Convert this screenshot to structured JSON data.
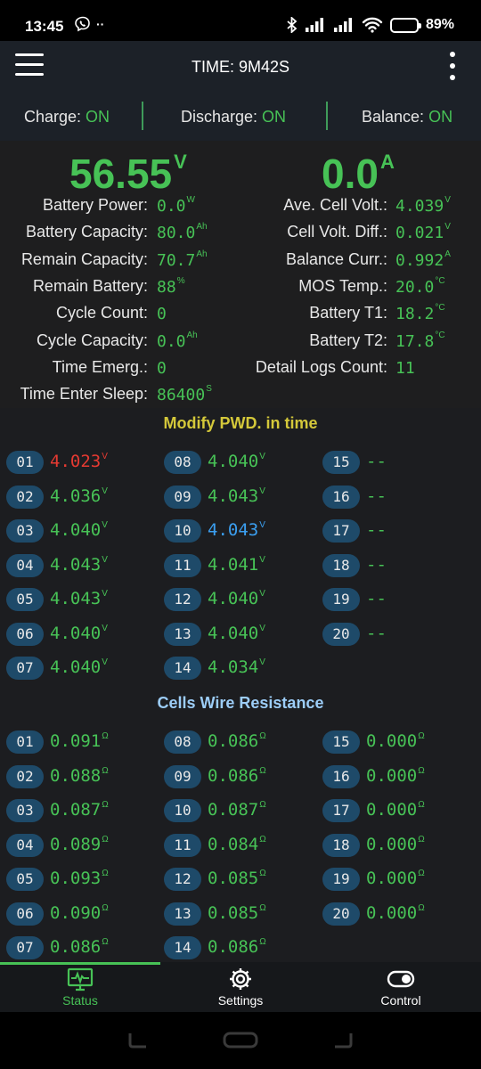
{
  "status_bar": {
    "time": "13:45",
    "battery_pct": "89%",
    "battery_level": 0.89
  },
  "app_bar": {
    "title": "TIME: 9M42S"
  },
  "modes": [
    {
      "label": "Charge: ",
      "state": "ON"
    },
    {
      "label": "Discharge: ",
      "state": "ON"
    },
    {
      "label": "Balance: ",
      "state": "ON"
    }
  ],
  "summary": {
    "voltage": "56.55",
    "voltage_unit": "V",
    "current": "0.0",
    "current_unit": "A",
    "left": [
      {
        "label": "Battery Power:",
        "value": "0.0",
        "unit": "W"
      },
      {
        "label": "Battery Capacity:",
        "value": "80.0",
        "unit": "Ah"
      },
      {
        "label": "Remain Capacity:",
        "value": "70.7",
        "unit": "Ah"
      },
      {
        "label": "Remain Battery:",
        "value": "88",
        "unit": "%"
      },
      {
        "label": "Cycle Count:",
        "value": "0",
        "unit": ""
      },
      {
        "label": "Cycle Capacity:",
        "value": "0.0",
        "unit": "Ah"
      },
      {
        "label": "Time Emerg.:",
        "value": "0",
        "unit": ""
      },
      {
        "label": "Time Enter Sleep:",
        "value": "86400",
        "unit": "S"
      }
    ],
    "right": [
      {
        "label": "Ave. Cell Volt.:",
        "value": "4.039",
        "unit": "V"
      },
      {
        "label": "Cell Volt. Diff.:",
        "value": "0.021",
        "unit": "V"
      },
      {
        "label": "Balance Curr.:",
        "value": "0.992",
        "unit": "A"
      },
      {
        "label": "MOS Temp.:",
        "value": "20.0",
        "unit": "°C"
      },
      {
        "label": "Battery T1:",
        "value": "18.2",
        "unit": "°C"
      },
      {
        "label": "Battery T2:",
        "value": "17.8",
        "unit": "°C"
      },
      {
        "label": "Detail Logs Count:",
        "value": "11",
        "unit": ""
      }
    ]
  },
  "voltages_title": "Modify PWD. in time",
  "cell_voltages": [
    {
      "id": "01",
      "value": "4.023",
      "unit": "V",
      "state": "min"
    },
    {
      "id": "02",
      "value": "4.036",
      "unit": "V",
      "state": ""
    },
    {
      "id": "03",
      "value": "4.040",
      "unit": "V",
      "state": ""
    },
    {
      "id": "04",
      "value": "4.043",
      "unit": "V",
      "state": ""
    },
    {
      "id": "05",
      "value": "4.043",
      "unit": "V",
      "state": ""
    },
    {
      "id": "06",
      "value": "4.040",
      "unit": "V",
      "state": ""
    },
    {
      "id": "07",
      "value": "4.040",
      "unit": "V",
      "state": ""
    },
    {
      "id": "08",
      "value": "4.040",
      "unit": "V",
      "state": ""
    },
    {
      "id": "09",
      "value": "4.043",
      "unit": "V",
      "state": ""
    },
    {
      "id": "10",
      "value": "4.043",
      "unit": "V",
      "state": "max"
    },
    {
      "id": "11",
      "value": "4.041",
      "unit": "V",
      "state": ""
    },
    {
      "id": "12",
      "value": "4.040",
      "unit": "V",
      "state": ""
    },
    {
      "id": "13",
      "value": "4.040",
      "unit": "V",
      "state": ""
    },
    {
      "id": "14",
      "value": "4.034",
      "unit": "V",
      "state": ""
    },
    {
      "id": "15",
      "value": "--",
      "unit": "",
      "state": ""
    },
    {
      "id": "16",
      "value": "--",
      "unit": "",
      "state": ""
    },
    {
      "id": "17",
      "value": "--",
      "unit": "",
      "state": ""
    },
    {
      "id": "18",
      "value": "--",
      "unit": "",
      "state": ""
    },
    {
      "id": "19",
      "value": "--",
      "unit": "",
      "state": ""
    },
    {
      "id": "20",
      "value": "--",
      "unit": "",
      "state": ""
    }
  ],
  "resistance_title": "Cells Wire Resistance",
  "cell_resistances": [
    {
      "id": "01",
      "value": "0.091",
      "unit": "Ω"
    },
    {
      "id": "02",
      "value": "0.088",
      "unit": "Ω"
    },
    {
      "id": "03",
      "value": "0.087",
      "unit": "Ω"
    },
    {
      "id": "04",
      "value": "0.089",
      "unit": "Ω"
    },
    {
      "id": "05",
      "value": "0.093",
      "unit": "Ω"
    },
    {
      "id": "06",
      "value": "0.090",
      "unit": "Ω"
    },
    {
      "id": "07",
      "value": "0.086",
      "unit": "Ω"
    },
    {
      "id": "08",
      "value": "0.086",
      "unit": "Ω"
    },
    {
      "id": "09",
      "value": "0.086",
      "unit": "Ω"
    },
    {
      "id": "10",
      "value": "0.087",
      "unit": "Ω"
    },
    {
      "id": "11",
      "value": "0.084",
      "unit": "Ω"
    },
    {
      "id": "12",
      "value": "0.085",
      "unit": "Ω"
    },
    {
      "id": "13",
      "value": "0.085",
      "unit": "Ω"
    },
    {
      "id": "14",
      "value": "0.086",
      "unit": "Ω"
    },
    {
      "id": "15",
      "value": "0.000",
      "unit": "Ω"
    },
    {
      "id": "16",
      "value": "0.000",
      "unit": "Ω"
    },
    {
      "id": "17",
      "value": "0.000",
      "unit": "Ω"
    },
    {
      "id": "18",
      "value": "0.000",
      "unit": "Ω"
    },
    {
      "id": "19",
      "value": "0.000",
      "unit": "Ω"
    },
    {
      "id": "20",
      "value": "0.000",
      "unit": "Ω"
    }
  ],
  "bottom_nav": [
    {
      "label": "Status",
      "icon": "status-monitor-icon",
      "active": true
    },
    {
      "label": "Settings",
      "icon": "gear-icon",
      "active": false
    },
    {
      "label": "Control",
      "icon": "toggle-icon",
      "active": false
    }
  ],
  "colors": {
    "accent_green": "#47c256",
    "min_cell": "#e53a32",
    "max_cell": "#3b9ff0",
    "pill_bg": "#1e4a69"
  }
}
